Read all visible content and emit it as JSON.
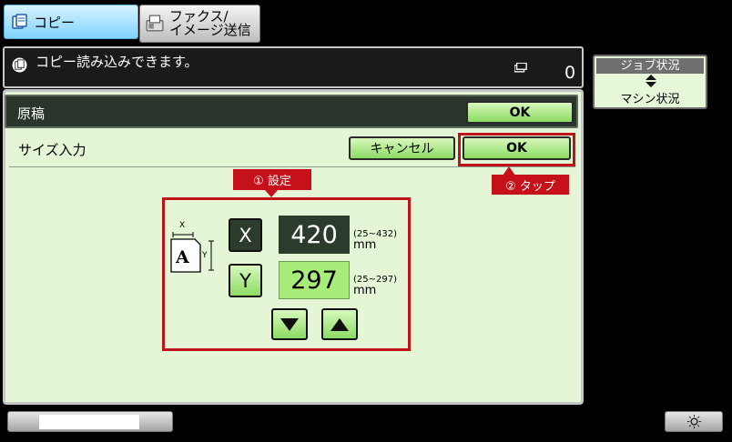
{
  "tabs": {
    "copy": "コピー",
    "fax_line1": "ファクス/",
    "fax_line2": "イメージ送信"
  },
  "status": {
    "message": "コピー読み込みできます。",
    "count": "0"
  },
  "original_row": {
    "label": "原稿",
    "ok": "OK"
  },
  "size_row": {
    "label": "サイズ入力",
    "cancel": "キャンセル",
    "ok": "OK"
  },
  "callouts": {
    "step1": "① 設定",
    "step2": "② タップ"
  },
  "size_input": {
    "x_label": "X",
    "y_label": "Y",
    "x_value": "420",
    "y_value": "297",
    "x_range": "(25~432)",
    "y_range": "(25~297)",
    "unit": "mm",
    "icon_x": "X",
    "icon_y": "Y",
    "icon_letter": "A"
  },
  "side": {
    "job_status": "ジョブ状況",
    "machine_status": "マシン状況"
  },
  "colors": {
    "accent_green": "#8cdc63",
    "callout_red": "#c6101a",
    "panel_bg": "#e5f6d6",
    "copy_tab": "#7fd3ff"
  }
}
